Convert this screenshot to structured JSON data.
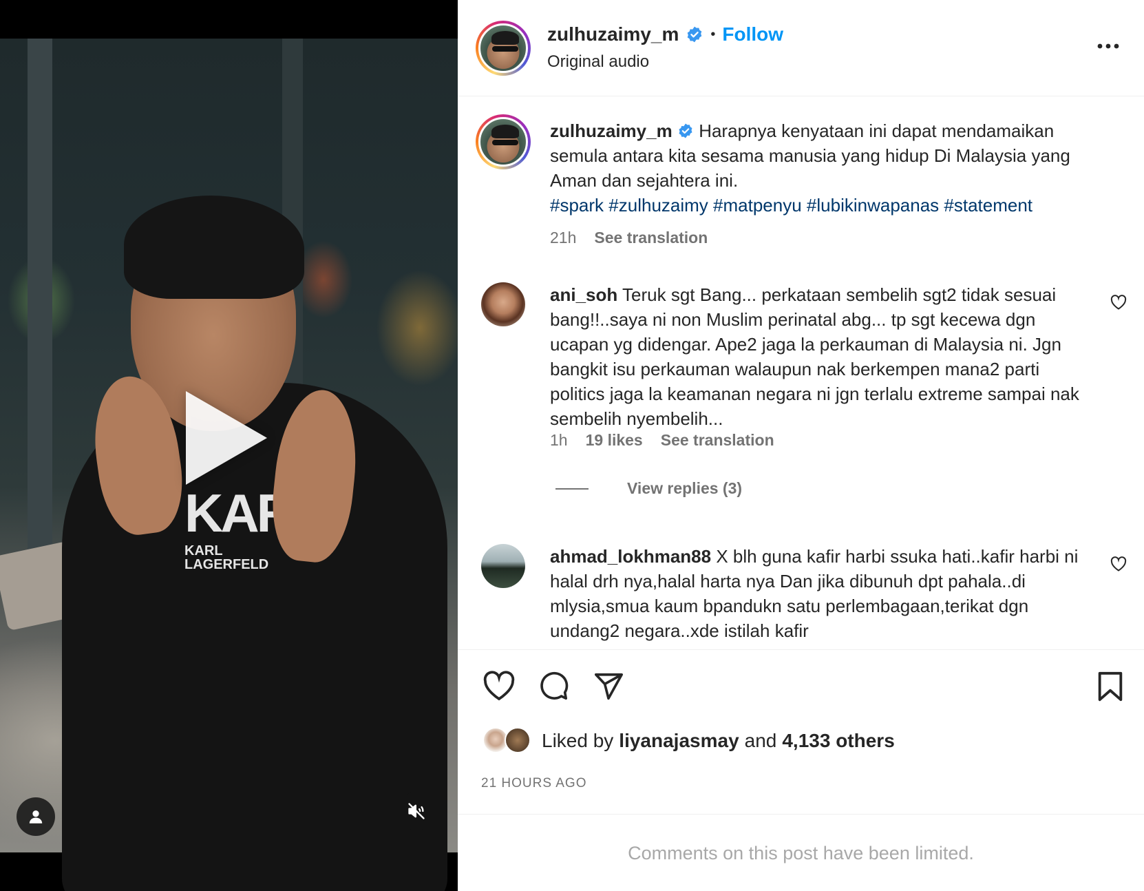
{
  "post": {
    "author": "zulhuzaimy_m",
    "follow_label": "Follow",
    "separator": "•",
    "audio": "Original audio"
  },
  "caption": {
    "username": "zulhuzaimy_m",
    "text": "Harapnya kenyataan ini dapat mendamaikan semula antara kita sesama manusia yang hidup Di Malaysia yang Aman dan sejahtera ini.",
    "hashtags": [
      "#spark",
      "#zulhuzaimy",
      "#matpenyu",
      "#lubikinwapanas",
      "#statement"
    ],
    "time": "21h",
    "see_translation": "See translation"
  },
  "comments": [
    {
      "username": "ani_soh",
      "text": "Teruk sgt Bang... perkataan sembelih sgt2 tidak sesuai bang!!..saya ni non Muslim perinatal abg... tp sgt kecewa dgn ucapan yg didengar. Ape2 jaga la perkauman di Malaysia ni. Jgn bangkit isu perkauman walaupun nak berkempen mana2 parti politics jaga la keamanan negara ni jgn terlalu extreme sampai nak sembelih nyembelih...",
      "time": "1h",
      "likes": "19 likes",
      "see_translation": "See translation",
      "view_replies": "View replies (3)"
    },
    {
      "username": "ahmad_lokhman88",
      "text": "X blh guna kafir harbi ssuka hati..kafir harbi ni halal drh nya,halal harta nya Dan jika dibunuh dpt pahala..di mlysia,smua kaum bpandukn satu perlembagaan,terikat dgn undang2 negara..xde istilah kafir"
    }
  ],
  "engagement": {
    "liked_by_prefix": "Liked by",
    "liked_by_user": "liyanajasmay",
    "and": "and",
    "others": "4,133 others",
    "timestamp": "21 HOURS AGO"
  },
  "footer": {
    "limited": "Comments on this post have been limited."
  },
  "icons": {
    "more": "more-options-icon",
    "like": "heart-icon",
    "comment": "comment-icon",
    "share": "send-icon",
    "save": "bookmark-icon",
    "mute": "sound-off-icon",
    "tagged": "tagged-user-icon",
    "play": "play-icon"
  },
  "colors": {
    "accent": "#0095f6",
    "hashtag": "#00376b",
    "verified": "#3897f0",
    "muted": "#737373"
  }
}
